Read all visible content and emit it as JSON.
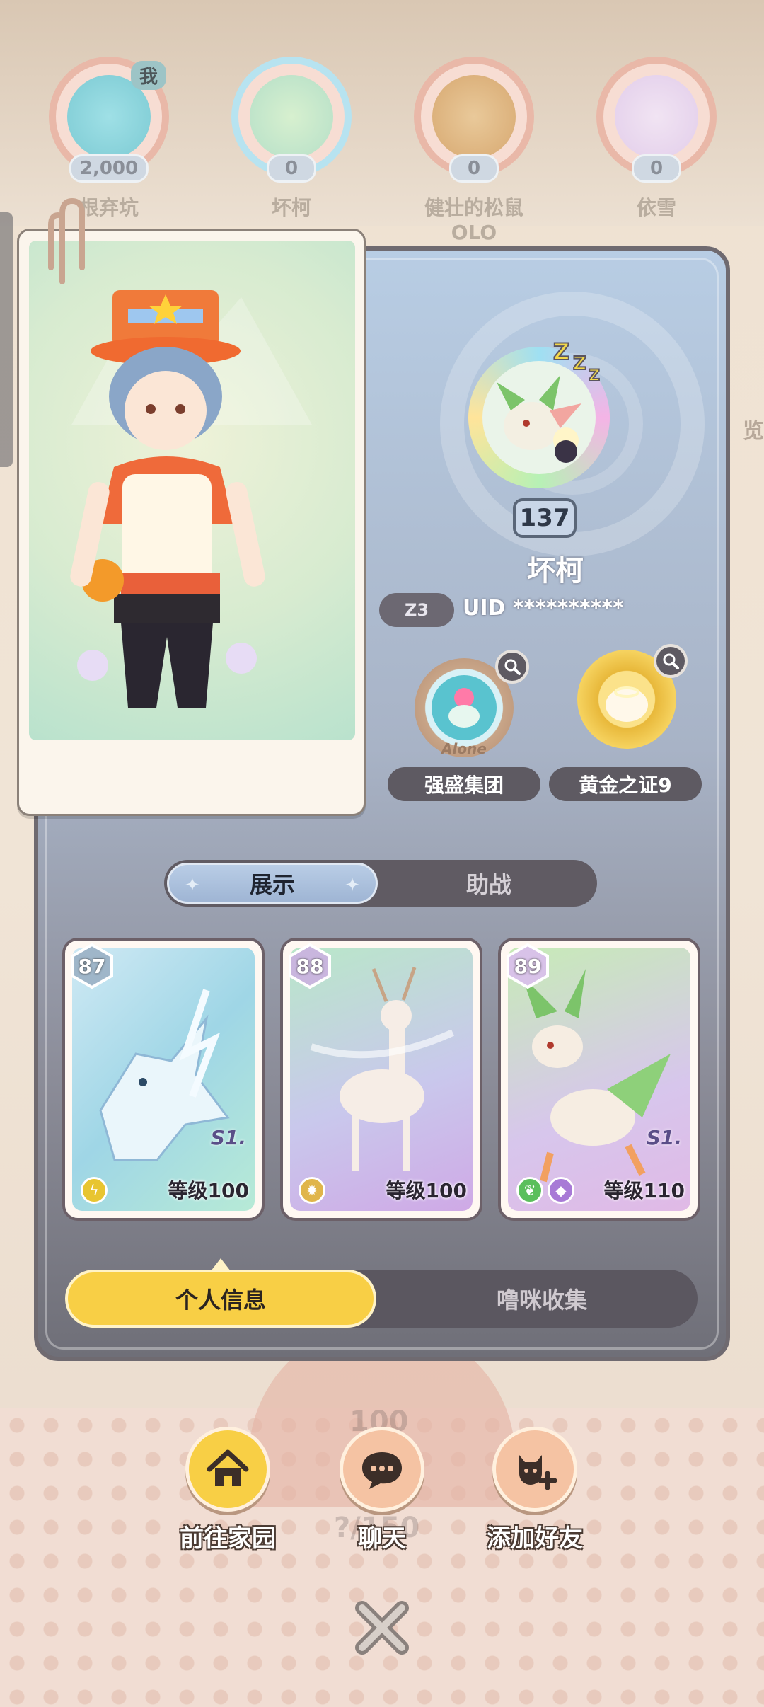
{
  "friends": [
    {
      "name": "根弃坑",
      "score": "2,000",
      "badge": "我"
    },
    {
      "name": "坏柯",
      "score": "0"
    },
    {
      "name": "健壮的松鼠OLO",
      "score": "0"
    },
    {
      "name": "依雪",
      "score": "0"
    }
  ],
  "side_hint": "览",
  "profile": {
    "level": "137",
    "name": "坏柯",
    "server": "Z3",
    "uid": "UID **********",
    "emblems": [
      {
        "label": "强盛集团",
        "ring_text": "Alone"
      },
      {
        "label": "黄金之证9"
      }
    ]
  },
  "tabs": {
    "active": "展示",
    "inactive": "助战"
  },
  "pets": [
    {
      "badge_level": "87",
      "grade": "S1.",
      "level_label": "等级100",
      "element_colors": [
        "#e8c531"
      ]
    },
    {
      "badge_level": "88",
      "level_label": "等级100",
      "element_colors": [
        "#e0b54a"
      ]
    },
    {
      "badge_level": "89",
      "grade": "S1.",
      "level_label": "等级110",
      "element_colors": [
        "#5bbf5c",
        "#a87ad6"
      ]
    }
  ],
  "bottom_tabs": {
    "active": "个人信息",
    "inactive": "噜咪收集"
  },
  "actions": [
    {
      "label": "前往家园",
      "icon": "home-icon",
      "color": "#f8cf45"
    },
    {
      "label": "聊天",
      "icon": "chat-bubble-icon",
      "color": "#f5c3a3"
    },
    {
      "label": "添加好友",
      "icon": "add-friend-icon",
      "color": "#f5c3a3"
    }
  ],
  "background_text": {
    "counter_top": "100",
    "counter_bottom": "?/150"
  }
}
